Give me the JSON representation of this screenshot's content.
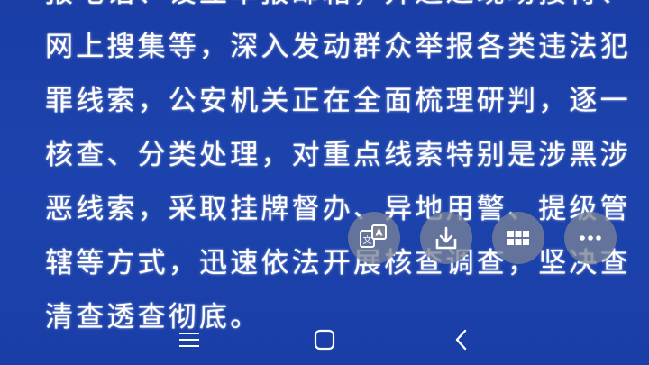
{
  "article": {
    "lines": [
      "报电话、设立举报邮箱，并通过现场接待、",
      "网上搜集等，深入发动群众举报各类违法犯",
      "罪线索，公安机关正在全面梳理研判，逐一",
      "核查、分类处理，对重点线索特别是涉黑涉",
      "恶线索，采取挂牌督办、异地用警、提级管",
      "辖等方式，迅速依法开展核查调查，坚决查",
      "清查透查彻底。"
    ]
  },
  "floating_actions": [
    {
      "name": "translate-icon",
      "glyph_a": "A",
      "glyph_b": "文"
    },
    {
      "name": "download-icon"
    },
    {
      "name": "grid-menu-icon"
    },
    {
      "name": "more-options-icon"
    }
  ],
  "navigation": {
    "buttons": [
      "menu-icon",
      "home-icon",
      "back-icon"
    ]
  },
  "colors": {
    "background": "#1b3fa6",
    "text": "#ffffff",
    "fab": "#7a8295"
  }
}
